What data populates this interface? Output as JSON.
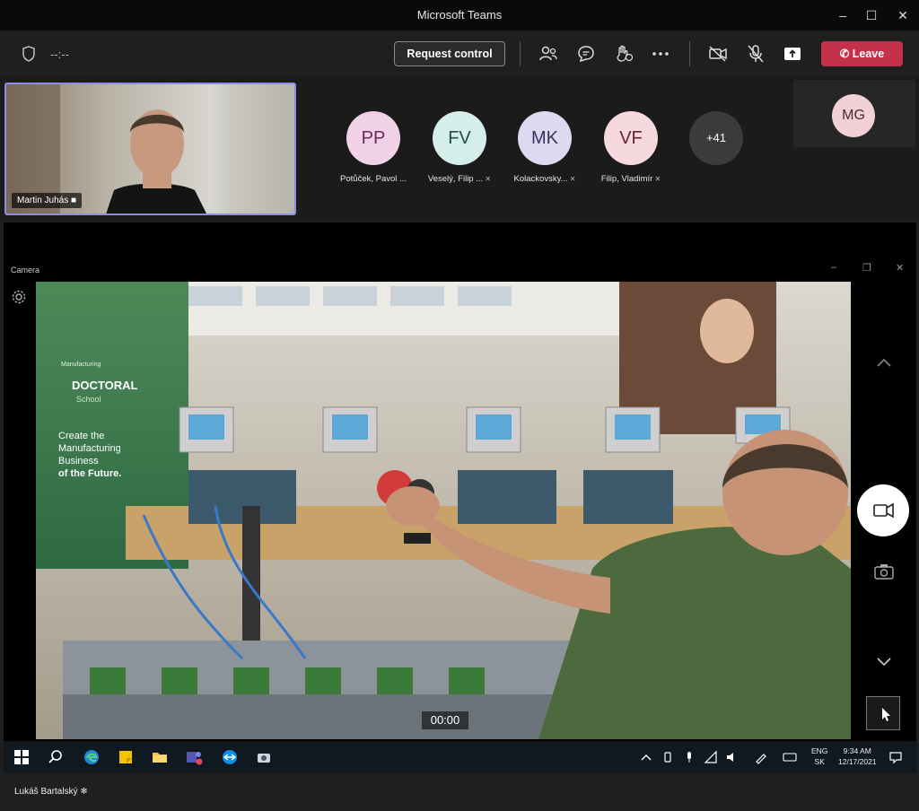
{
  "window": {
    "title": "Microsoft Teams"
  },
  "toolbar": {
    "timer": "--:--",
    "request_control_label": "Request control",
    "leave_label": "Leave"
  },
  "self_view": {
    "name": "Martin Juhás"
  },
  "participants": [
    {
      "initials": "PP",
      "name": "Potůček, Pavol ...",
      "bg": "#f1d1e6",
      "fg": "#6a2a5a",
      "muted": false
    },
    {
      "initials": "FV",
      "name": "Veselý, Filip ...",
      "bg": "#d5eeea",
      "fg": "#1f4f4a",
      "muted": true
    },
    {
      "initials": "MK",
      "name": "Kolackovsky...",
      "bg": "#ddd9f0",
      "fg": "#3a3361",
      "muted": true
    },
    {
      "initials": "VF",
      "name": "Filip, Vladimír",
      "bg": "#f6d9df",
      "fg": "#6a2233",
      "muted": true
    }
  ],
  "overflow_count": "+41",
  "corner_participant": {
    "initials": "MG"
  },
  "camera_app": {
    "title": "Camera",
    "timecode": "00:00",
    "banner": {
      "brand": "Manufacturing",
      "line1": "DOCTORAL",
      "line2": "School",
      "slogan1": "Create the",
      "slogan2": "Manufacturing",
      "slogan3": "Business",
      "slogan4": "of the Future."
    }
  },
  "taskbar": {
    "lang1": "ENG",
    "lang2": "SK",
    "time": "9:34 AM",
    "date": "12/17/2021"
  },
  "presenter": {
    "name": "Lukáš Bartalský"
  },
  "colors": {
    "accent": "#8b8ee6",
    "leave": "#c4314b"
  }
}
